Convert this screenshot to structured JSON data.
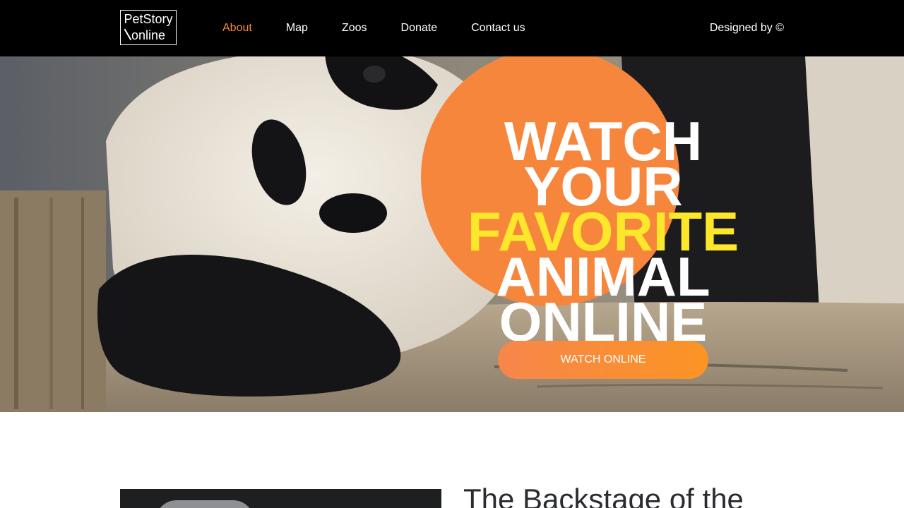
{
  "header": {
    "logo": {
      "line1": "PetStory",
      "line2": "online"
    },
    "nav": [
      {
        "label": "About",
        "active": true
      },
      {
        "label": "Map",
        "active": false
      },
      {
        "label": "Zoos",
        "active": false
      },
      {
        "label": "Donate",
        "active": false
      },
      {
        "label": "Contact us",
        "active": false
      }
    ],
    "credit": "Designed by ©"
  },
  "hero": {
    "headline": {
      "line1": "WATCH",
      "line2": "YOUR",
      "line3": "FAVORITE",
      "line4": "ANIMAL",
      "line5": "ONLINE"
    },
    "cta_label": "WATCH ONLINE",
    "image": "panda-photo"
  },
  "section": {
    "title": "The Backstage of the"
  },
  "colors": {
    "header_bg": "#000000",
    "accent_orange": "#f7883a",
    "highlight_yellow": "#fde72a",
    "text_white": "#ffffff"
  }
}
